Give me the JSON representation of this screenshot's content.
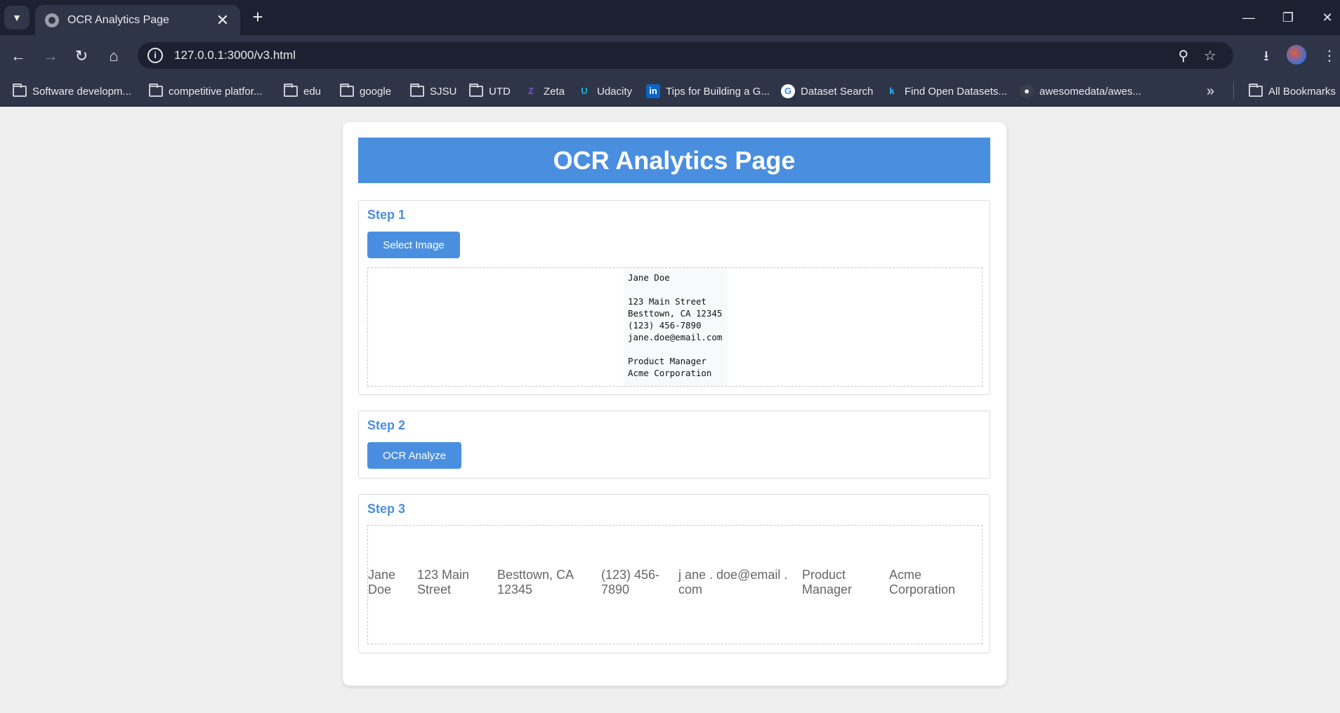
{
  "browser": {
    "tab_title": "OCR Analytics Page",
    "tab_close": "✕",
    "new_tab": "+",
    "url": "127.0.0.1:3000/v3.html",
    "bookmarks": [
      {
        "label": "Software developm...",
        "icon": "folder-icon"
      },
      {
        "label": "competitive platfor...",
        "icon": "folder-icon"
      },
      {
        "label": "edu",
        "icon": "folder-icon"
      },
      {
        "label": "google",
        "icon": "folder-icon"
      },
      {
        "label": "SJSU",
        "icon": "folder-icon"
      },
      {
        "label": "UTD",
        "icon": "folder-icon"
      },
      {
        "label": "Zeta",
        "icon": "zeta-icon"
      },
      {
        "label": "Udacity",
        "icon": "udacity-icon"
      },
      {
        "label": "Tips for Building a G...",
        "icon": "linkedin-icon"
      },
      {
        "label": "Dataset Search",
        "icon": "google-icon"
      },
      {
        "label": "Find Open Datasets...",
        "icon": "kaggle-icon"
      },
      {
        "label": "awesomedata/awes...",
        "icon": "github-icon"
      }
    ],
    "all_bookmarks": "All Bookmarks",
    "overflow": "»"
  },
  "page": {
    "title": "OCR Analytics Page",
    "step1": {
      "title": "Step 1",
      "button": "Select Image",
      "image_lines": [
        "Jane Doe",
        "",
        "123 Main Street",
        "Besttown, CA 12345",
        "(123) 456-7890",
        "jane.doe@email.com",
        "",
        "Product Manager",
        "Acme Corporation"
      ]
    },
    "step2": {
      "title": "Step 2",
      "button": "OCR Analyze"
    },
    "step3": {
      "title": "Step 3",
      "results": [
        "Jane Doe",
        "123 Main Street",
        "Besttown, CA 12345",
        "(123) 456-7890",
        "j ane . doe@email . com",
        "Product Manager",
        "Acme Corporation"
      ]
    }
  },
  "colors": {
    "accent": "#4a8fdf",
    "chrome_dark": "#1b2130",
    "chrome": "#2e3548",
    "page_bg": "#efefef"
  }
}
